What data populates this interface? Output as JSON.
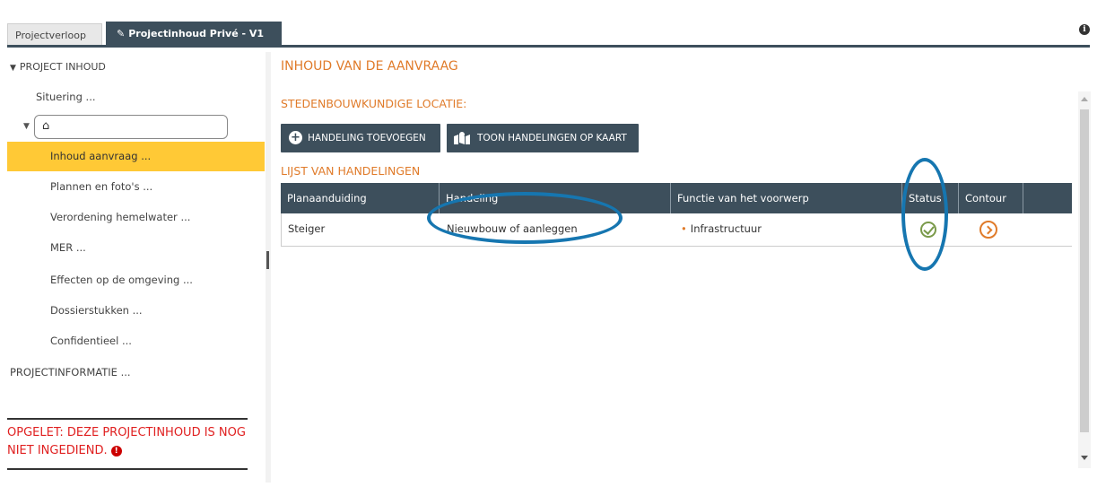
{
  "tabs": [
    {
      "label": "Projectverloop",
      "active": false
    },
    {
      "label": "Projectinhoud Privé - V1",
      "active": true
    }
  ],
  "sidebar": {
    "root_label": "PROJECT INHOUD",
    "items": [
      {
        "label": "Situering ..."
      },
      {
        "label": "Inhoud aanvraag ...",
        "active": true
      },
      {
        "label": "Plannen en foto's ..."
      },
      {
        "label": "Verordening hemelwater ..."
      },
      {
        "label": "MER ..."
      },
      {
        "label": "Effecten op de omgeving ..."
      },
      {
        "label": "Dossierstukken ..."
      },
      {
        "label": "Confidentieel ..."
      }
    ],
    "projectinfo_label": "PROJECTINFORMATIE ...",
    "warning": "OPGELET: DEZE PROJECTINHOUD IS NOG NIET INGEDIEND."
  },
  "main": {
    "title": "INHOUD VAN DE AANVRAAG",
    "section_location": "STEDENBOUWKUNDIGE LOCATIE:",
    "btn_add": "HANDELING TOEVOEGEN",
    "btn_map": "TOON HANDELINGEN OP KAART",
    "section_list": "LIJST VAN HANDELINGEN",
    "columns": [
      "Planaanduiding",
      "Handeling",
      "Functie van het voorwerp",
      "Status",
      "Contour"
    ],
    "rows": [
      {
        "planaanduiding": "Steiger",
        "handeling": "Nieuwbouw of aanleggen",
        "functie": "Infrastructuur"
      }
    ]
  },
  "colors": {
    "accent": "#e07b2a",
    "dark": "#3d4f5c",
    "highlight": "#ffc936",
    "warning": "#e02020",
    "annotation": "#1676b0"
  }
}
